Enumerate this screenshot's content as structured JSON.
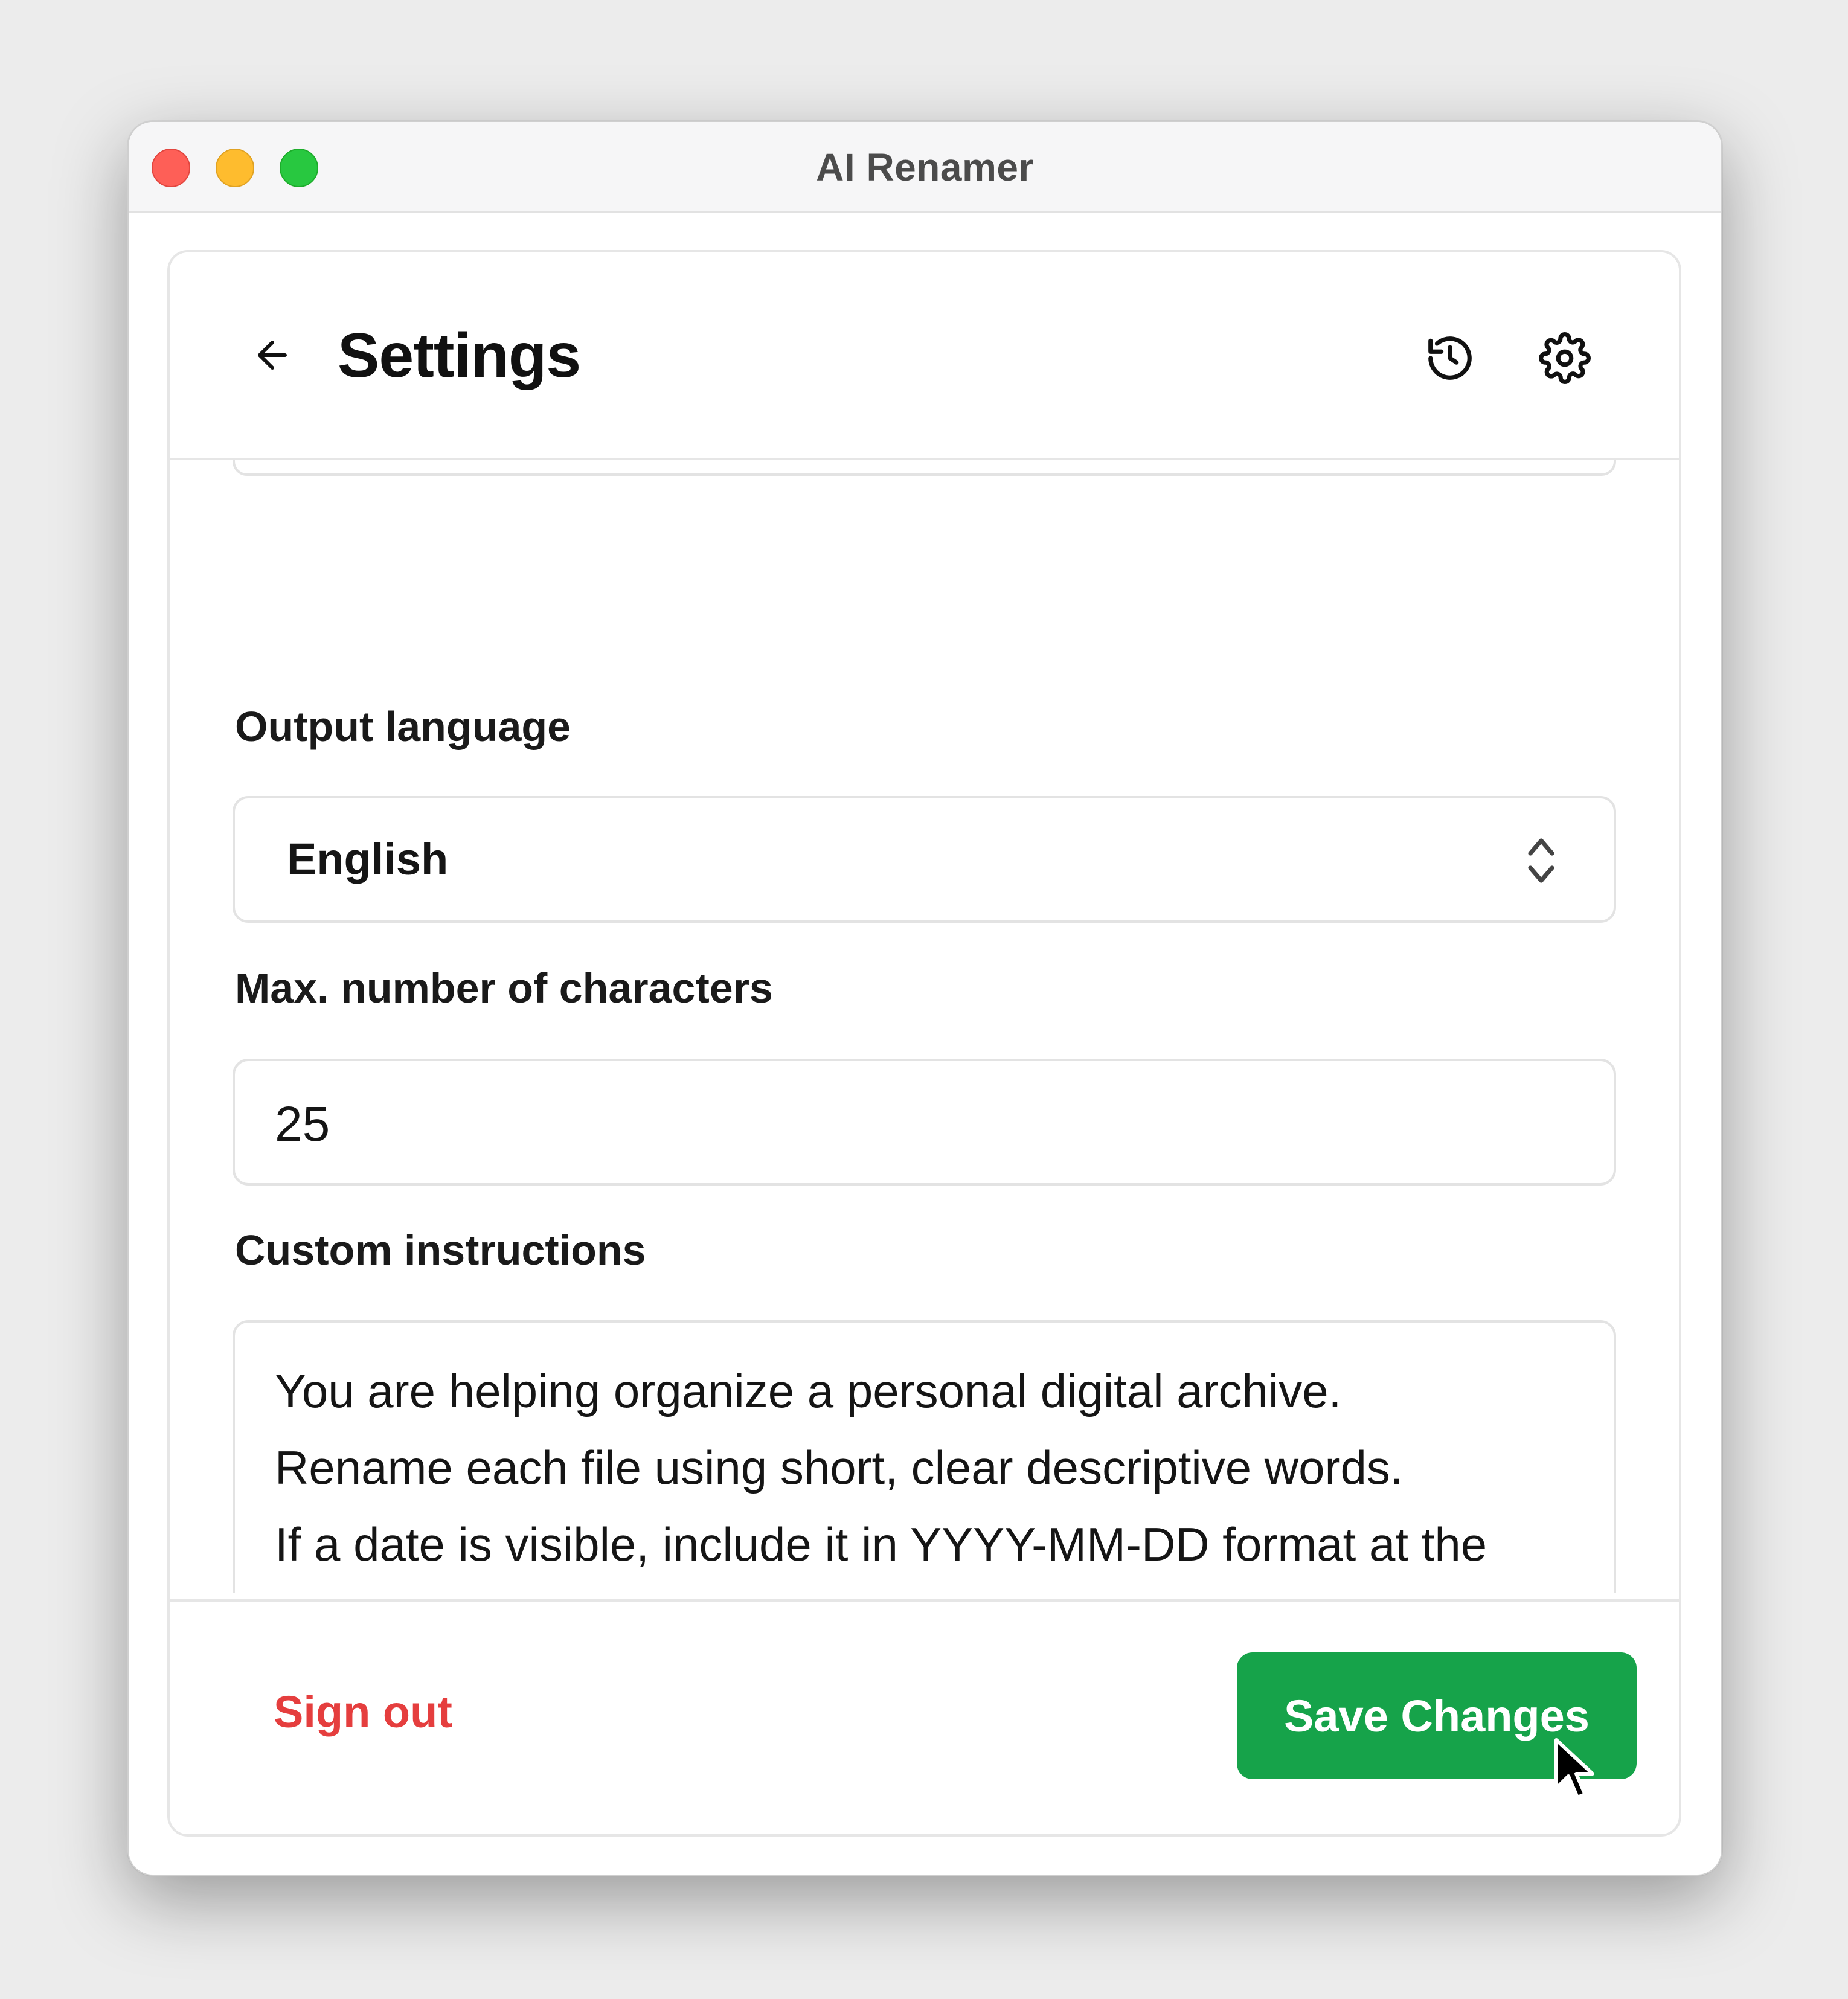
{
  "window": {
    "title": "AI Renamer"
  },
  "header": {
    "title": "Settings",
    "back_icon": "arrow-left-icon",
    "history_icon": "history-icon",
    "settings_icon": "gear-icon"
  },
  "fields": {
    "output_language": {
      "label": "Output language",
      "value": "English"
    },
    "max_characters": {
      "label": "Max. number of characters",
      "value": "25"
    },
    "custom_instructions": {
      "label": "Custom instructions",
      "value": "You are helping organize a personal digital archive.\nRename each file using short, clear descriptive words.\nIf a date is visible, include it in YYYY-MM-DD format at the beginning.\nIf no date is visible, skip the date."
    }
  },
  "footer": {
    "sign_out_label": "Sign out",
    "save_label": "Save Changes"
  },
  "colors": {
    "accent_green": "#16a34a",
    "danger_red": "#e53e3e",
    "traffic_close": "#fe5f57",
    "traffic_minimize": "#febc2e",
    "traffic_maximize": "#28c840"
  }
}
